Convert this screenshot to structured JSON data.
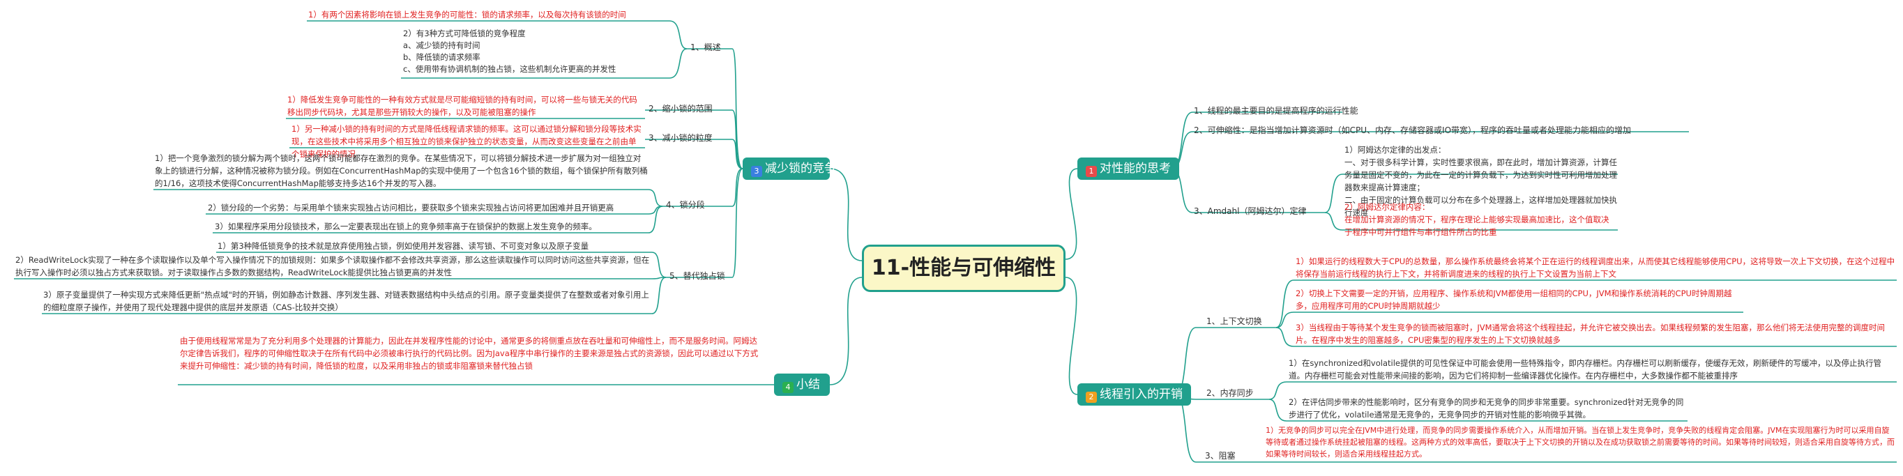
{
  "title": "11-性能与可伸缩性",
  "colors": {
    "branch": "#21a08d",
    "badge_1": "#e84a4a",
    "badge_2": "#f0a020",
    "badge_3": "#3a7fe0",
    "badge_4": "#2bb050",
    "line": "#21a08d",
    "red_text": "#e02020"
  },
  "b1": {
    "badge": "1",
    "label": "对性能的思考",
    "c1": "1、线程的最主要目的是提高程序的运行性能",
    "c2": "2、可伸缩性：是指当增加计算资源时（如CPU、内存、存储容器或IO带宽），程序的吞吐量或者处理能力能相应的增加",
    "c3": "3、Amdahl（阿姆达尔）定律",
    "amdahl1": "1）阿姆达尔定律的出发点：\n一、对于很多科学计算，实时性要求很高，即在此时，增加计算资源，计算任务量是固定不变的，为此在一定的计算负载下，为达到实时性可利用增加处理器数来提高计算速度；\n二、由于固定的计算负载可以分布在多个处理器上，这样增加处理器就加快执行速度",
    "amdahl2": "2）阿姆达尔定律内容：\n在增加计算资源的情况下，程序在理论上能够实现最高加速比，这个值取决于程序中可并行组件与串行组件所占的比重"
  },
  "b2": {
    "badge": "2",
    "label": "线程引入的开销",
    "c1": "1、上下文切换",
    "c2": "2、内存同步",
    "c3": "3、阻塞",
    "ctx1": "1）如果运行的线程数大于CPU的总数量，那么操作系统最终会将某个正在运行的线程调度出来，从而使其它线程能够使用CPU，这将导致一次上下文切换，在这个过程中将保存当前运行线程的执行上下文，并将新调度进来的线程的执行上下文设置为当前上下文",
    "ctx2": "2）切换上下文需要一定的开销，应用程序、操作系统和JVM都使用一组相同的CPU，JVM和操作系统消耗的CPU时钟周期越多，应用程序可用的CPU时钟周期就越少",
    "ctx3": "3）当线程由于等待某个发生竞争的锁而被阻塞时，JVM通常会将这个线程挂起，并允许它被交换出去。如果线程频繁的发生阻塞，那么他们将无法使用完整的调度时间片。在程序中发生的阻塞越多，CPU密集型的程序发生的上下文切换就越多",
    "mem1": "1）在synchronized和volatile提供的可见性保证中可能会使用一些特殊指令，即内存栅栏。内存栅栏可以刷新缓存，使缓存无效，刷新硬件的写缓冲，以及停止执行管道。内存栅栏可能会对性能带来间接的影响，因为它们将抑制一些编译器优化操作。在内存栅栏中，大多数操作都不能被重排序",
    "mem2": "2）在评估同步带来的性能影响时，区分有竞争的同步和无竞争的同步非常重要。synchronized针对无竞争的同步进行了优化，volatile通常是无竞争的，无竞争同步的开销对性能的影响微乎其微。",
    "block1": "1）无竞争的同步可以完全在JVM中进行处理，而竞争的同步需要操作系统介入，从而增加开销。当在锁上发生竞争时，竞争失败的线程肯定会阻塞。JVM在实现阻塞行为时可以采用自旋等待或者通过操作系统挂起被阻塞的线程。这两种方式的效率高低，要取决于上下文切换的开销以及在成功获取锁之前需要等待的时间。如果等待时间较短，则适合采用自旋等待方式，而如果等待时间较长，则适合采用线程挂起方式。"
  },
  "b3": {
    "badge": "3",
    "label": "减少锁的竞争",
    "c1": "1、概述",
    "c2": "2、缩小锁的范围",
    "c3": "3、减小锁的粒度",
    "c4": "4、锁分段",
    "c5": "5、替代独占锁",
    "ov1": "1）有两个因素将影响在锁上发生竞争的可能性：锁的请求频率，以及每次持有该锁的时间",
    "ov2": "2）有3种方式可降低锁的竞争程度\na、减少锁的持有时间\nb、降低锁的请求频率\nc、使用带有协调机制的独占锁，这些机制允许更高的并发性",
    "scope1": "1）降低发生竞争可能性的一种有效方式就是尽可能缩短锁的持有时间，可以将一些与锁无关的代码移出同步代码块，尤其是那些开销较大的操作，以及可能被阻塞的操作",
    "gran1": "1）另一种减小锁的持有时间的方式是降低线程请求锁的频率。这可以通过锁分解和锁分段等技术实现，在这些技术中将采用多个相互独立的锁来保护独立的状态变量，从而改变这些变量在之前由单个锁来保护的情况",
    "seg1": "1）把一个竞争激烈的锁分解为两个锁时，这两个锁可能都存在激烈的竞争。在某些情况下，可以将锁分解技术进一步扩展为对一组独立对象上的锁进行分解，这种情况被称为锁分段。例如在ConcurrentHashMap的实现中使用了一个包含16个锁的数组，每个锁保护所有散列桶的1/16，这项技术使得ConcurrentHashMap能够支持多达16个并发的写入器。",
    "seg2": "2）锁分段的一个劣势：与采用单个锁来实现独占访问相比，要获取多个锁来实现独占访问将更加困难并且开销更高",
    "seg3": "3）如果程序采用分段锁技术，那么一定要表现出在锁上的竞争频率高于在锁保护的数据上发生竞争的频率。",
    "alt1": "1）第3种降低锁竞争的技术就是放弃使用独占锁，例如使用并发容器、读写锁、不可变对象以及原子变量",
    "alt2": "2）ReadWriteLock实现了一种在多个读取操作以及单个写入操作情况下的加锁规则：如果多个读取操作都不会修改共享资源，那么这些读取操作可以同时访问这些共享资源，但在执行写入操作时必须以独占方式来获取锁。对于读取操作占多数的数据结构，ReadWriteLock能提供比独占锁更高的并发性",
    "alt3": "3）原子变量提供了一种实现方式来降低更新\"热点域\"时的开销，例如静态计数器、序列发生器、对链表数据结构中头结点的引用。原子变量类提供了在整数或者对象引用上的细粒度原子操作，并使用了现代处理器中提供的底层并发原语（CAS-比较并交换）"
  },
  "b4": {
    "badge": "4",
    "label": "小结",
    "text": "由于使用线程常常是为了充分利用多个处理器的计算能力，因此在并发程序性能的讨论中，通常更多的将侧重点放在吞吐量和可伸缩性上，而不是服务时间。阿姆达尔定律告诉我们，程序的可伸缩性取决于在所有代码中必须被串行执行的代码比例。因为Java程序中串行操作的主要来源是独占式的资源锁，因此可以通过以下方式来提升可伸缩性：减少锁的持有时间，降低锁的粒度，以及采用非独占的锁或非阻塞锁来替代独占锁"
  }
}
